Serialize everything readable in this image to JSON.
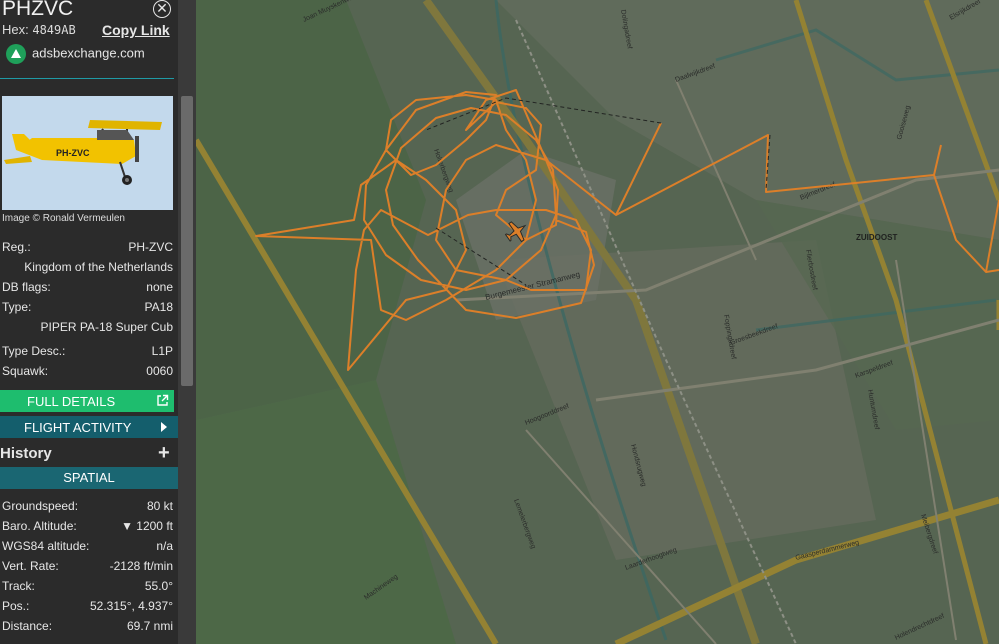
{
  "aircraft": {
    "callsign": "PHZVC",
    "hex_label": "Hex:",
    "hex": "4849AB",
    "copy_link": "Copy Link",
    "source": "adsbexchange.com",
    "photo_tail": "PH-ZVC",
    "photo_credit": "Image © Ronald Vermeulen"
  },
  "details": {
    "reg_label": "Reg.:",
    "reg": "PH-ZVC",
    "country": "Kingdom of the Netherlands",
    "db_flags_label": "DB flags:",
    "db_flags": "none",
    "type_label": "Type:",
    "type": "PA18",
    "type_name": "PIPER PA-18 Super Cub",
    "type_desc_label": "Type Desc.:",
    "type_desc": "L1P",
    "squawk_label": "Squawk:",
    "squawk": "0060"
  },
  "buttons": {
    "full_details": "FULL DETAILS",
    "flight_activity": "FLIGHT ACTIVITY"
  },
  "history": {
    "title": "History",
    "add": "+",
    "spatial": "SPATIAL"
  },
  "spatial": {
    "groundspeed_label": "Groundspeed:",
    "groundspeed": "80 kt",
    "baro_label": "Baro. Altitude:",
    "baro": "▼ 1200 ft",
    "wgs_label": "WGS84 altitude:",
    "wgs": "n/a",
    "vrate_label": "Vert. Rate:",
    "vrate": "-2128 ft/min",
    "track_label": "Track:",
    "track": "55.0°",
    "pos_label": "Pos.:",
    "pos": "52.315°, 4.937°",
    "distance_label": "Distance:",
    "distance": "69.7 nmi"
  },
  "map": {
    "streets": [
      "Daalwijkdreef",
      "Dolingadreef",
      "Bijlmerdreef",
      "Holterbergweg",
      "Burgemeester Stramanweg",
      "Hoogoorddreef",
      "Huntumdreef",
      "Karspeldreef",
      "Gaasperdammerweg",
      "Meibergdreef",
      "Foppingadreef",
      "Flierbosdreef",
      "Lemelerbergweg",
      "Laarderhoogtweg",
      "Machineweg",
      "Joan Muyskenweg",
      "Gooiseweg",
      "Elsrijkdreef",
      "Holendrechtdreef",
      "Groesbeekdreef",
      "Hondsrugweg"
    ],
    "district": "ZUIDOOST",
    "track_color": "#f5892a"
  }
}
